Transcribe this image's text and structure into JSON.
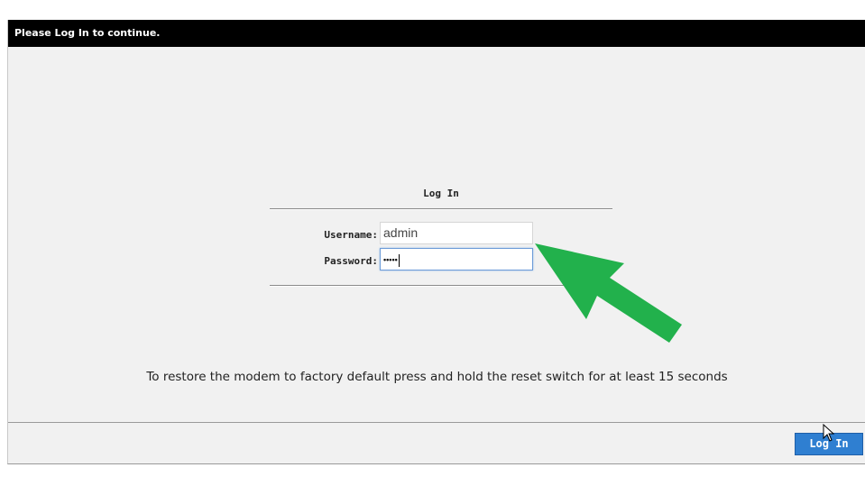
{
  "window": {
    "title": "Please Log In to continue."
  },
  "login_form": {
    "heading": "Log In",
    "username_label": "Username:",
    "username_value": "admin",
    "password_label": "Password:",
    "password_value": "•••••"
  },
  "notice": {
    "restore_text": "To restore the modem to factory default press and hold the reset switch for at least 15 seconds"
  },
  "footer": {
    "login_button_label": "Log In"
  },
  "colors": {
    "title_bar": "#000000",
    "page_background": "#f1f1f1",
    "button": "#2f7fd1",
    "annotation_arrow": "#22b14c"
  },
  "icons": {
    "annotation": "green-arrow-icon",
    "pointer": "mouse-cursor-icon"
  }
}
